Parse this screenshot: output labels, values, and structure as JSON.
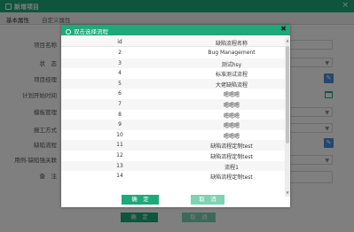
{
  "window": {
    "title": "新增项目",
    "close": "×"
  },
  "tabs": [
    "基本属性",
    "自定义属性"
  ],
  "form": {
    "labels": [
      "项目名称",
      "状　态",
      "项目经理",
      "计划开始时间",
      "模板管理",
      "报工方式",
      "缺陷流程",
      "用例-缺陷强关联",
      "备　注"
    ],
    "select_hint": "化 例"
  },
  "outer_buttons": {
    "ok": "确　定",
    "cancel": "取　消"
  },
  "dialog": {
    "title": "双击选择流程",
    "close": "✖",
    "columns": [
      "id",
      "缺陷流程名称"
    ],
    "rows": [
      {
        "id": "2",
        "name": "Bug Management"
      },
      {
        "id": "3",
        "name": "测试hsy"
      },
      {
        "id": "4",
        "name": "标准测试流程"
      },
      {
        "id": "5",
        "name": "大佬缺陷流程"
      },
      {
        "id": "6",
        "name": "嗯嗯嗯"
      },
      {
        "id": "7",
        "name": "嗯嗯嗯"
      },
      {
        "id": "8",
        "name": "嗯嗯嗯"
      },
      {
        "id": "9",
        "name": "嗯嗯嗯"
      },
      {
        "id": "10",
        "name": "嗯嗯嗯"
      },
      {
        "id": "11",
        "name": "缺陷流程定制test"
      },
      {
        "id": "12",
        "name": "缺陷流程定制test"
      },
      {
        "id": "13",
        "name": "流程1"
      },
      {
        "id": "14",
        "name": "缺陷流程定制test"
      }
    ],
    "ok": "确　定",
    "cancel": "取　消"
  },
  "colors": {
    "accent": "#1fa87a",
    "accent_light": "#7dd3b4",
    "pencil": "#4a8fd6"
  }
}
